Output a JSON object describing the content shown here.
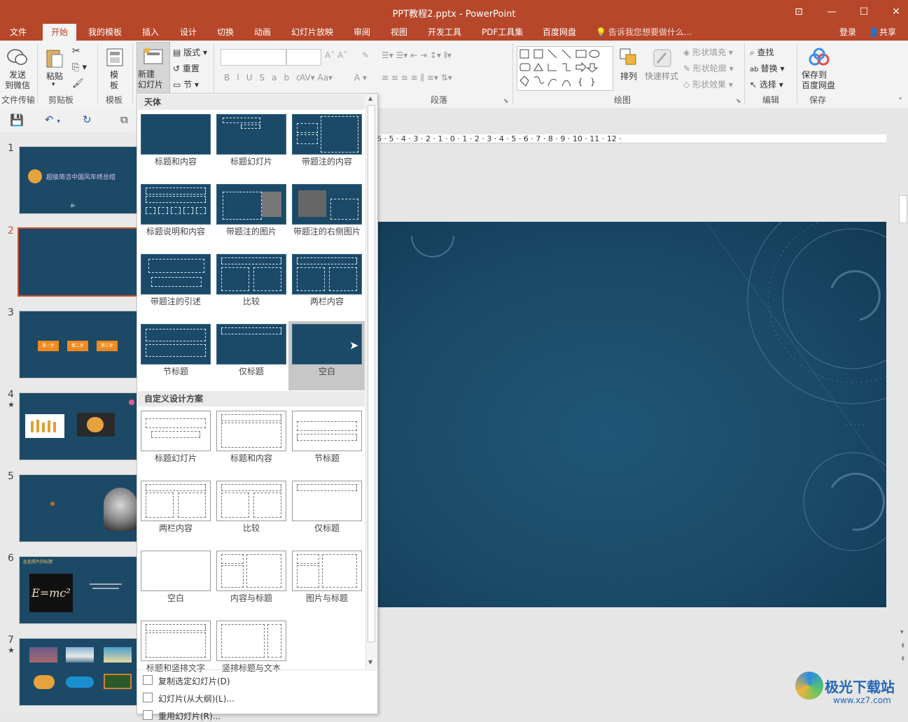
{
  "window": {
    "title": "PPT教程2.pptx - PowerPoint",
    "controls": [
      "restore-ribbon",
      "minimize",
      "maximize",
      "close"
    ]
  },
  "tabs": [
    "文件",
    "开始",
    "我的模板",
    "插入",
    "设计",
    "切换",
    "动画",
    "幻灯片放映",
    "审阅",
    "视图",
    "开发工具",
    "PDF工具集",
    "百度网盘"
  ],
  "active_tab": "开始",
  "tell_me": "告诉我您想要做什么...",
  "login": "登录",
  "share": "共享",
  "ribbon": {
    "send_wechat": "发送\n到微信",
    "paste": "粘贴",
    "template": "模\n板",
    "new_slide": "新建\n幻灯片",
    "layout": "版式",
    "reset": "重置",
    "section": "节",
    "arrange": "排列",
    "quick_styles": "快速样式",
    "shape_fill": "形状填充",
    "shape_outline": "形状轮廓",
    "shape_effect": "形状效果",
    "find": "查找",
    "replace": "替换",
    "select": "选择",
    "save_baidu": "保存到\n百度网盘",
    "groups": {
      "file_transfer": "文件传输",
      "clipboard": "剪贴板",
      "template": "模板",
      "paragraph": "段落",
      "drawing": "绘图",
      "editing": "编辑",
      "save": "保存"
    }
  },
  "slides": [
    {
      "num": "1",
      "star": ""
    },
    {
      "num": "2",
      "star": ""
    },
    {
      "num": "3",
      "star": ""
    },
    {
      "num": "4",
      "star": "★"
    },
    {
      "num": "5",
      "star": ""
    },
    {
      "num": "6",
      "star": ""
    },
    {
      "num": "7",
      "star": "★"
    }
  ],
  "selected_slide": "2",
  "slide_thumb_text": {
    "s1_title": "超级简洁中国风年终总结",
    "s3_steps": [
      "第一步",
      "第二步",
      "第三步"
    ],
    "s6_title": "此处照片的标题",
    "s6_formula": "E=mc²"
  },
  "gallery": {
    "section1": "天体",
    "section1_layouts": [
      "标题和内容",
      "标题幻灯片",
      "带题注的内容",
      "标题说明和内容",
      "带题注的图片",
      "带题注的右侧图片",
      "带题注的引述",
      "比较",
      "两栏内容",
      "节标题",
      "仅标题",
      "空白"
    ],
    "selected_layout": "空白",
    "section2": "自定义设计方案",
    "section2_layouts": [
      "标题幻灯片",
      "标题和内容",
      "节标题",
      "两栏内容",
      "比较",
      "仅标题",
      "空白",
      "内容与标题",
      "图片与标题",
      "标题和竖排文字",
      "竖排标题与文本"
    ],
    "footer": [
      "复制选定幻灯片(D)",
      "幻灯片(从大纲)(L)...",
      "重用幻灯片(R)..."
    ]
  },
  "ruler_text": "6 · 5 · 4 · 3 · 2 · 1 · 0 · 1 · 2 · 3 · 4 · 5 · 6 · 7 · 8 · 9 · 10 · 11 · 12 ·",
  "watermark": {
    "brand": "极光下载站",
    "url": "www.xz7.com"
  },
  "colors": {
    "accent": "#b7472a",
    "slide_bg": "#1c4a66",
    "selected_border": "#d0502f"
  }
}
